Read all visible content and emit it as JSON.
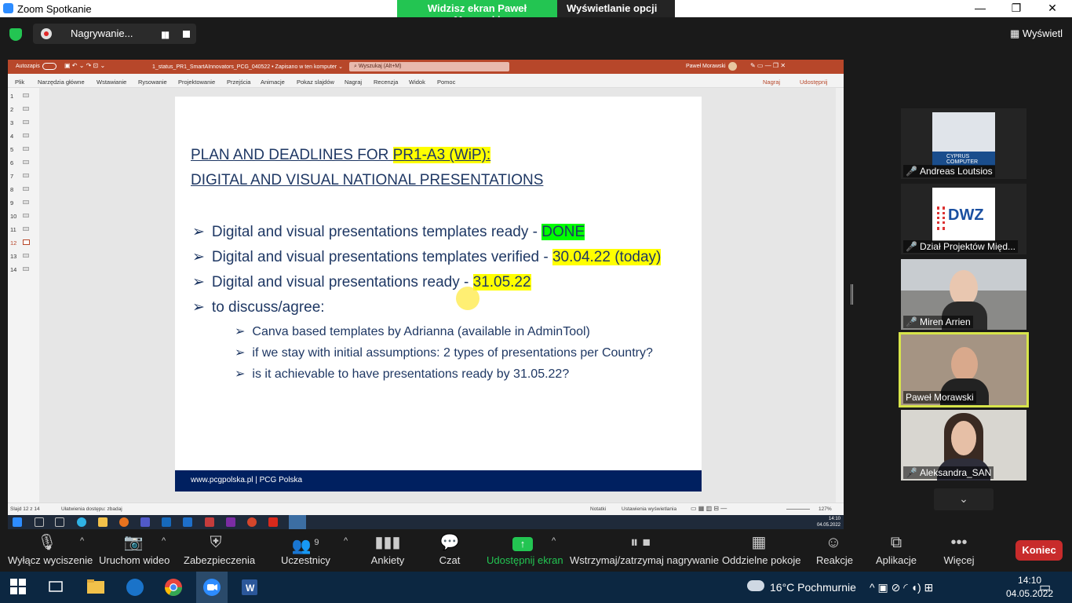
{
  "window": {
    "title": "Zoom Spotkanie",
    "minimize": "—",
    "restore": "❐",
    "close": "✕"
  },
  "share_banner": {
    "viewing": "Widzisz ekran Paweł Morawski",
    "options": "Wyświetlanie opcji ⌄"
  },
  "recording": {
    "label": "Nagrywanie...",
    "pause": "▮▮"
  },
  "view_button": "Wyświetl",
  "ppt": {
    "autosave": "Autozapis",
    "filename": "1_status_PR1_SmartAInnovators_PCG_040522 • Zapisano w ten komputer ⌄",
    "search_placeholder": "Wyszukaj (Alt+M)",
    "user": "Paweł Morawski",
    "menu": [
      "Plik",
      "Narzędzia główne",
      "Wstawianie",
      "Rysowanie",
      "Projektowanie",
      "Przejścia",
      "Animacje",
      "Pokaz slajdów",
      "Nagraj",
      "Recenzja",
      "Widok",
      "Pomoc"
    ],
    "record_btn": "Nagraj",
    "share_btn": "Udostępnij",
    "slide_numbers": [
      "1",
      "2",
      "3",
      "4",
      "5",
      "6",
      "7",
      "8",
      "9",
      "10",
      "11",
      "12",
      "13",
      "14"
    ],
    "selected_slide": "12",
    "status_left": "Slajd 12 z 14",
    "accessibility": "Ułatwienia dostępu: zbadaj",
    "notes": "Notatki",
    "display_settings": "Ustawienia wyświetlania",
    "zoom": "127%"
  },
  "slide": {
    "title_line1_pre": "PLAN AND DEADLINES FOR ",
    "title_line1_hl": "PR1-A3 (WiP):",
    "title_line2": "DIGITAL AND VISUAL NATIONAL PRESENTATIONS",
    "bullets": [
      {
        "text": "Digital and visual presentations templates ready - ",
        "tag": "DONE"
      },
      {
        "text": "Digital and visual presentations templates verified - ",
        "tag": "30.04.22 (today)"
      },
      {
        "text": "Digital and visual presentations ready - ",
        "tag": "31.05.22"
      },
      {
        "text": "to discuss/agree:",
        "tag": ""
      }
    ],
    "sub_bullets": [
      "Canva based templates by Adrianna (available in AdminTool)",
      "if we stay with initial assumptions: 2 types of presentations per Country?",
      "is it achievable to have presentations ready by 31.05.22?"
    ],
    "footer": "www.pcgpolska.pl | PCG Polska",
    "arrow": "➢"
  },
  "inner_taskbar": {
    "time": "14:10",
    "date": "04.05.2022"
  },
  "participants": [
    {
      "name": "Andreas Loutsios",
      "logo_text": "CYPRUS COMPUTER"
    },
    {
      "name": "Dział Projektów Międ...",
      "logo_text": "DWZ"
    },
    {
      "name": "Miren Arrien",
      "logo_text": ""
    },
    {
      "name": "Paweł Morawski",
      "logo_text": ""
    },
    {
      "name": "Aleksandra_SAN",
      "logo_text": ""
    }
  ],
  "toolbar": {
    "mute": "Wyłącz wyciszenie",
    "video": "Uruchom wideo",
    "security": "Zabezpieczenia",
    "participants": "Uczestnicy",
    "participants_count": "9",
    "polls": "Ankiety",
    "chat": "Czat",
    "share": "Udostępnij ekran",
    "record": "Wstrzymaj/zatrzymaj nagrywanie",
    "breakout": "Oddzielne pokoje",
    "reactions": "Reakcje",
    "apps": "Aplikacje",
    "more": "Więcej",
    "end": "Koniec"
  },
  "win_taskbar": {
    "weather": "16°C  Pochmurnie",
    "time": "14:10",
    "date": "04.05.2022"
  },
  "colors": {
    "zoom_green": "#23c552",
    "ppt_red": "#b7472a",
    "slide_navy": "#1f3864",
    "end_red": "#c82b2b",
    "active_border": "#d7e44a"
  }
}
